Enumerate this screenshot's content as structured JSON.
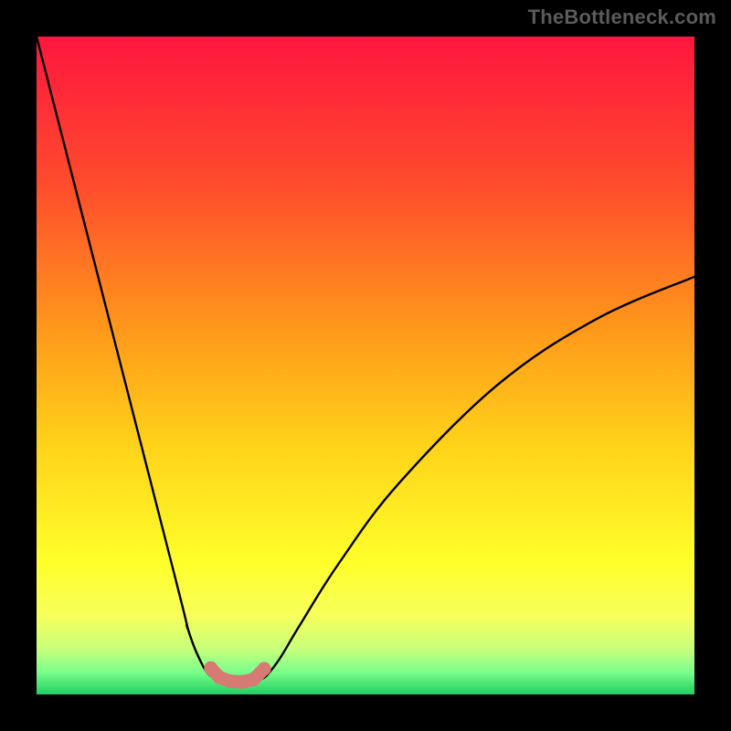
{
  "watermark": "TheBottleneck.com",
  "chart_data": {
    "type": "line",
    "title": "",
    "xlabel": "",
    "ylabel": "",
    "xlim": [
      0,
      100
    ],
    "ylim": [
      0,
      100
    ],
    "grid": false,
    "legend": false,
    "gradient_stops": [
      {
        "offset": 0,
        "color": "#ff163f"
      },
      {
        "offset": 0.22,
        "color": "#ff4a2d"
      },
      {
        "offset": 0.45,
        "color": "#ff9a1a"
      },
      {
        "offset": 0.62,
        "color": "#ffd21a"
      },
      {
        "offset": 0.8,
        "color": "#ffff2a"
      },
      {
        "offset": 0.88,
        "color": "#f7ff5a"
      },
      {
        "offset": 0.93,
        "color": "#c8ff7a"
      },
      {
        "offset": 0.965,
        "color": "#7dff8c"
      },
      {
        "offset": 1.0,
        "color": "#1fd061"
      }
    ],
    "series": [
      {
        "name": "left-branch",
        "x": [
          0.0,
          20.5,
          23.0,
          25.2,
          26.6,
          27.5
        ],
        "y": [
          100.0,
          20.0,
          10.0,
          4.5,
          2.7,
          2.3
        ]
      },
      {
        "name": "right-branch",
        "x": [
          34.0,
          35.0,
          37.0,
          40.0,
          46.0,
          55.0,
          70.0,
          85.0,
          100.0
        ],
        "y": [
          2.3,
          2.9,
          5.5,
          10.5,
          20.0,
          32.0,
          47.0,
          57.0,
          63.5
        ]
      }
    ],
    "valley_marker": {
      "name": "valley-dots",
      "color": "#d87a74",
      "radius_pct": 1.05,
      "points": [
        {
          "x": 26.5,
          "y": 4.0
        },
        {
          "x": 27.8,
          "y": 2.6
        },
        {
          "x": 29.5,
          "y": 2.0
        },
        {
          "x": 31.2,
          "y": 1.9
        },
        {
          "x": 33.0,
          "y": 2.3
        },
        {
          "x": 34.6,
          "y": 3.9
        }
      ]
    }
  }
}
